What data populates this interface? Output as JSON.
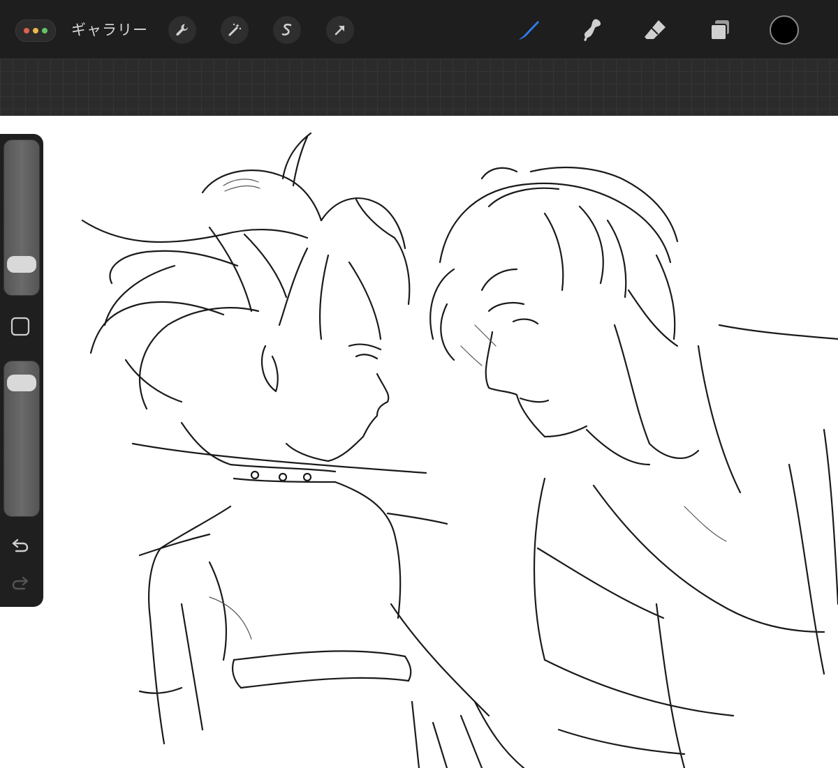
{
  "topbar": {
    "gallery_label": "ギャラリー",
    "menu_dots": [
      "#e0614f",
      "#e9b94a",
      "#65c466"
    ],
    "left_tools": [
      {
        "name": "wrench-icon",
        "label": "actions"
      },
      {
        "name": "magic-wand-icon",
        "label": "adjustments"
      },
      {
        "name": "selection-icon",
        "label": "selection"
      },
      {
        "name": "transform-arrow-icon",
        "label": "transform"
      }
    ],
    "right_tools": [
      {
        "name": "brush-icon",
        "active": true
      },
      {
        "name": "smudge-icon",
        "active": false
      },
      {
        "name": "eraser-icon",
        "active": false
      },
      {
        "name": "layers-icon",
        "active": false
      }
    ],
    "active_color": "#000000",
    "accent_color": "#2f7cf6"
  },
  "sidebar": {
    "brush_size_level": 0.85,
    "opacity_level": 0.92,
    "icons": [
      "modify-square-icon",
      "undo-icon",
      "redo-icon"
    ]
  },
  "canvas": {
    "background": "#ffffff",
    "content": "pencil-sketch-artwork"
  }
}
